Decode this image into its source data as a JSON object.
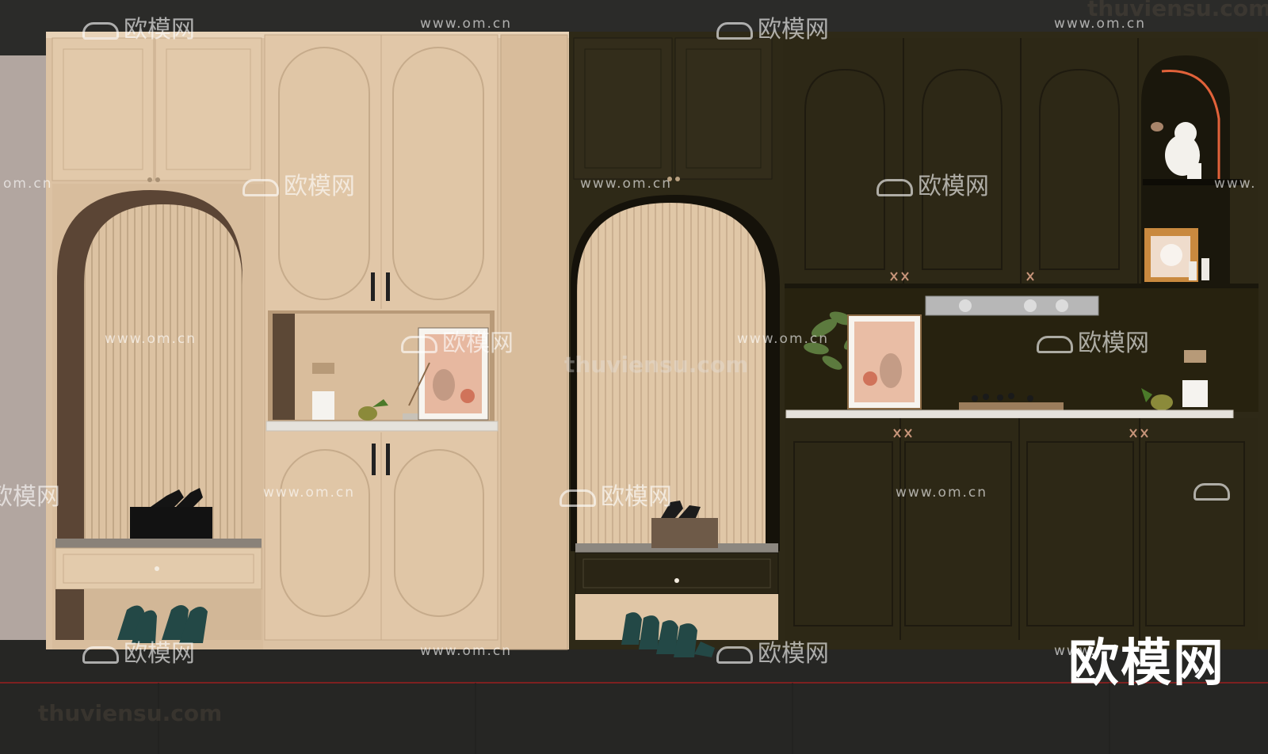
{
  "watermarks": {
    "url": "www.om.cn",
    "logo": "欧模网",
    "site": "thuviensu.com",
    "partial_url_left": "om.cn",
    "partial_logo_left": "欧模网",
    "partial_url_right": "www.",
    "partial_url_bottom": "www.",
    "corner_logo": "欧模网"
  },
  "colors": {
    "background": "#2d2c2a",
    "floor": "#262624",
    "beige_cabinet": "#e2c8a8",
    "dark_cabinet": "#2f2a18",
    "marble": "#e6e4df",
    "shoe_teal": "#244a48",
    "floor_line": "#9b1f1f"
  }
}
